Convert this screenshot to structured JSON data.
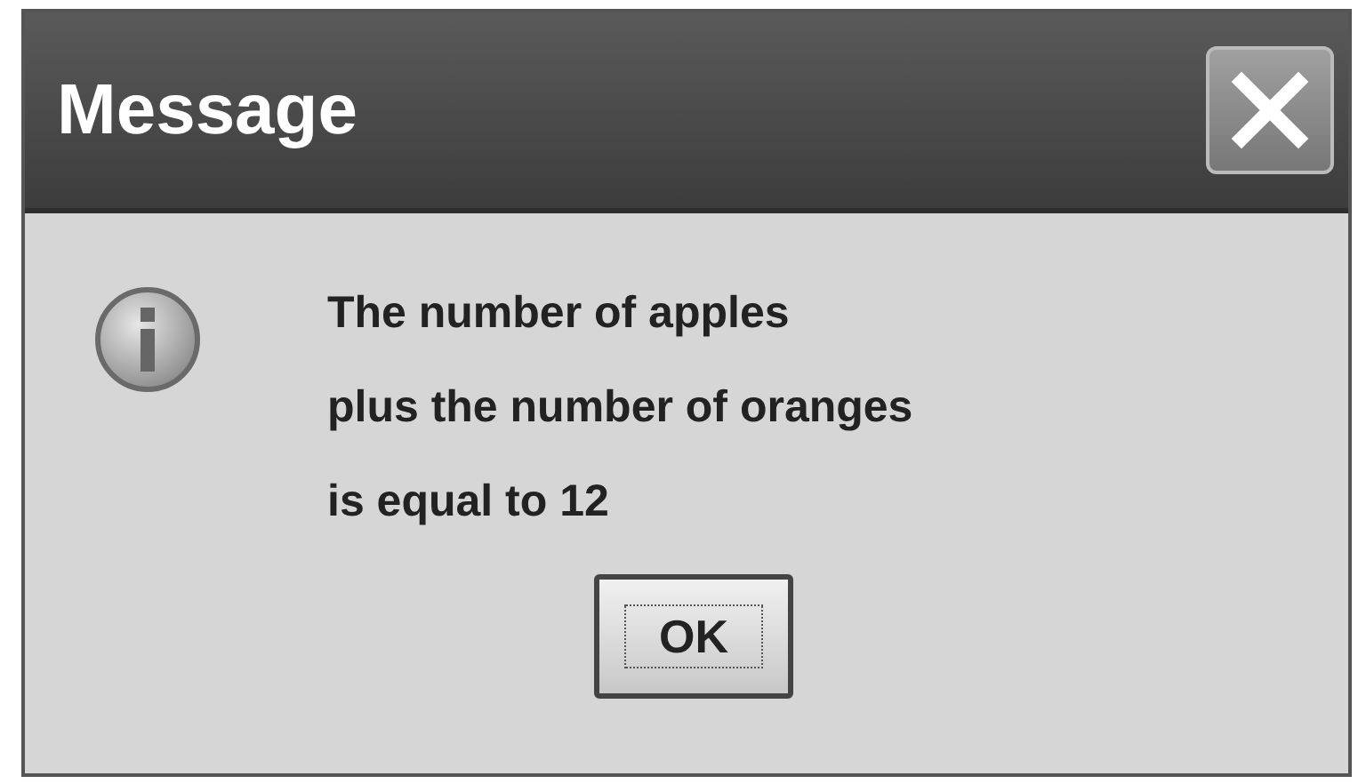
{
  "window": {
    "title": "Message"
  },
  "message": "The number of apples\nplus the number of oranges\nis equal to 12",
  "buttons": [
    {
      "label": "OK",
      "focused": true
    }
  ]
}
